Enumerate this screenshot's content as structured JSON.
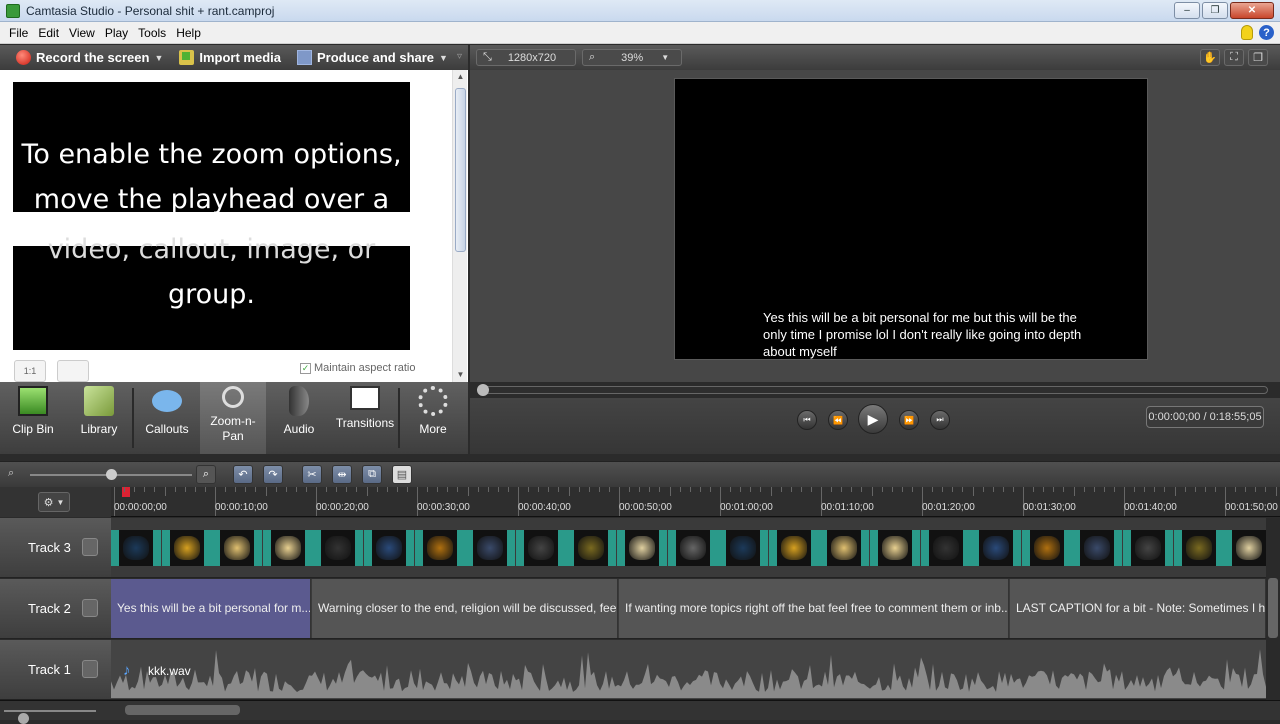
{
  "window": {
    "title": "Camtasia Studio - Personal shit + rant.camproj"
  },
  "menu": [
    "File",
    "Edit",
    "View",
    "Play",
    "Tools",
    "Help"
  ],
  "toolbar": {
    "record": "Record the screen",
    "import": "Import media",
    "produce": "Produce and share"
  },
  "zoom_panel": {
    "message_line1": "To enable the zoom options,",
    "message_line2": "move the playhead over a",
    "message_line3": "video, callout, image, or",
    "message_line4": "group.",
    "btn_11": "1:1",
    "maintain_aspect": "Maintain aspect ratio"
  },
  "tabs": [
    {
      "label": "Clip Bin"
    },
    {
      "label": "Library"
    },
    {
      "label": "Callouts"
    },
    {
      "label": "Zoom-n-Pan",
      "active": true
    },
    {
      "label": "Audio"
    },
    {
      "label": "Transitions"
    },
    {
      "label": "More"
    }
  ],
  "preview": {
    "dimensions": "1280x720",
    "zoom": "39%",
    "caption": "Yes this will be a bit personal for me but this will be the only time I promise lol I don't really like going into depth about myself",
    "time": "0:00:00;00 / 0:18:55;05"
  },
  "ruler": [
    "00:00:00;00",
    "00:00:10;00",
    "00:00:20;00",
    "00:00:30;00",
    "00:00:40;00",
    "00:00:50;00",
    "00:01:00;00",
    "00:01:10;00",
    "00:01:20;00",
    "00:01:30;00",
    "00:01:40;00",
    "00:01:50;00"
  ],
  "tracks": [
    {
      "name": "Track 3"
    },
    {
      "name": "Track 2"
    },
    {
      "name": "Track 1"
    }
  ],
  "captions": [
    "Yes this will be a bit personal for m...",
    "Warning closer to the end, religion will be  discussed, fee...",
    "If wanting more topics right off the bat feel free to  comment them or inb...",
    "LAST CAPTION for a bit - Note: Sometimes I  have"
  ],
  "audio_clip": "kkk.wav",
  "colors": {
    "selected_caption": "#5b5a8f",
    "clip_edge": "#2a9a8a",
    "playhead": "#dd2233"
  }
}
